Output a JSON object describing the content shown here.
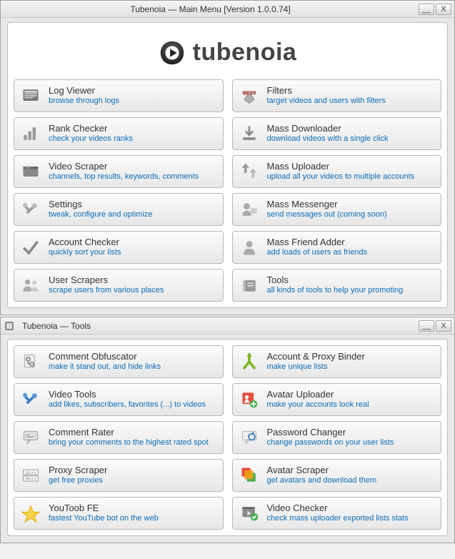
{
  "window1": {
    "title": "Tubenoia — Main Menu  [Version 1.0.0.74]",
    "minimize": "__",
    "close": "X",
    "logo_text": "tubenoia",
    "items": [
      {
        "icon": "log-viewer-icon",
        "title": "Log Viewer",
        "sub": "browse through logs"
      },
      {
        "icon": "filters-icon",
        "title": "Filters",
        "sub": "target videos and users with filters"
      },
      {
        "icon": "rank-checker-icon",
        "title": "Rank Checker",
        "sub": "check your videos ranks"
      },
      {
        "icon": "mass-downloader-icon",
        "title": "Mass Downloader",
        "sub": "download videos with a single click"
      },
      {
        "icon": "video-scraper-icon",
        "title": "Video Scraper",
        "sub": "channels, top results, keywords, comments"
      },
      {
        "icon": "mass-uploader-icon",
        "title": "Mass Uploader",
        "sub": "upload all your videos to multiple accounts"
      },
      {
        "icon": "settings-icon",
        "title": "Settings",
        "sub": "tweak, configure and optimize"
      },
      {
        "icon": "mass-messenger-icon",
        "title": "Mass Messenger",
        "sub": "send messages out (coming soon)"
      },
      {
        "icon": "account-checker-icon",
        "title": "Account Checker",
        "sub": "quickly sort your lists"
      },
      {
        "icon": "mass-friend-adder-icon",
        "title": "Mass Friend Adder",
        "sub": "add loads of users as friends"
      },
      {
        "icon": "user-scrapers-icon",
        "title": "User Scrapers",
        "sub": "scrape users from various places"
      },
      {
        "icon": "tools-icon",
        "title": "Tools",
        "sub": "all kinds of tools to help your promoting"
      }
    ]
  },
  "window2": {
    "title": "Tubenoia — Tools",
    "minimize": "__",
    "close": "X",
    "items": [
      {
        "icon": "comment-obfuscator-icon",
        "title": "Comment Obfuscator",
        "sub": "make it stand out, and hide links"
      },
      {
        "icon": "account-proxy-binder-icon",
        "title": "Account & Proxy Binder",
        "sub": "make unique lists"
      },
      {
        "icon": "video-tools-icon",
        "title": "Video Tools",
        "sub": "add likes, subscribers, favorites (...) to videos"
      },
      {
        "icon": "avatar-uploader-icon",
        "title": "Avatar Uploader",
        "sub": "make your accounts look real"
      },
      {
        "icon": "comment-rater-icon",
        "title": "Comment Rater",
        "sub": "bring your comments to the highest rated spot"
      },
      {
        "icon": "password-changer-icon",
        "title": "Password Changer",
        "sub": "change passwords on your user lists"
      },
      {
        "icon": "proxy-scraper-icon",
        "title": "Proxy Scraper",
        "sub": "get free proxies"
      },
      {
        "icon": "avatar-scraper-icon",
        "title": "Avatar Scraper",
        "sub": "get avatars and download them"
      },
      {
        "icon": "youtoob-fe-icon",
        "title": "YouToob FE",
        "sub": "fastest YouTube bot on the web"
      },
      {
        "icon": "video-checker-icon",
        "title": "Video Checker",
        "sub": "check mass uploader exported lists stats"
      }
    ]
  }
}
